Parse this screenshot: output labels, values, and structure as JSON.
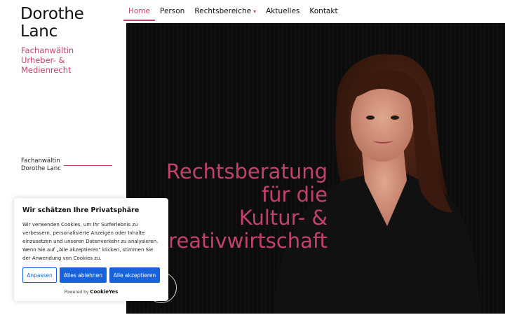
{
  "brand": {
    "name_line1": "Dorothe",
    "name_line2": "Lanc",
    "subtitle_line1": "Fachanwältin",
    "subtitle_line2": "Urheber- &",
    "subtitle_line3": "Medienrecht"
  },
  "sidebar": {
    "credit_line1": "Fachanwältin",
    "credit_line2": "Dorothe Lanc"
  },
  "nav": {
    "items": [
      {
        "label": "Home",
        "active": true
      },
      {
        "label": "Person"
      },
      {
        "label": "Rechtsbereiche",
        "has_dropdown": true
      },
      {
        "label": "Aktuelles"
      },
      {
        "label": "Kontakt"
      }
    ]
  },
  "hero": {
    "heading_line1": "Rechtsberatung",
    "heading_line2": "für die",
    "heading_line3": "Kultur- &",
    "heading_line4": "Kreativwirtschaft"
  },
  "cookie": {
    "title": "Wir schätzen Ihre Privatsphäre",
    "text": "Wir verwenden Cookies, um Ihr Surferlebnis zu verbessern, personalisierte Anzeigen oder Inhalte einzusetzen und unseren Datenverkehr zu analysieren. Wenn Sie auf „Alle akzeptieren\" klicken, stimmen Sie der Anwendung von Cookies zu.",
    "customize_label": "Anpassen",
    "reject_label": "Alles ablehnen",
    "accept_label": "Alle akzeptieren",
    "powered_prefix": "Powered by",
    "powered_brand": "CookieYes"
  },
  "colors": {
    "accent": "#c2426e",
    "button_blue": "#1863dc",
    "hero_bg": "#0c0c0c"
  }
}
